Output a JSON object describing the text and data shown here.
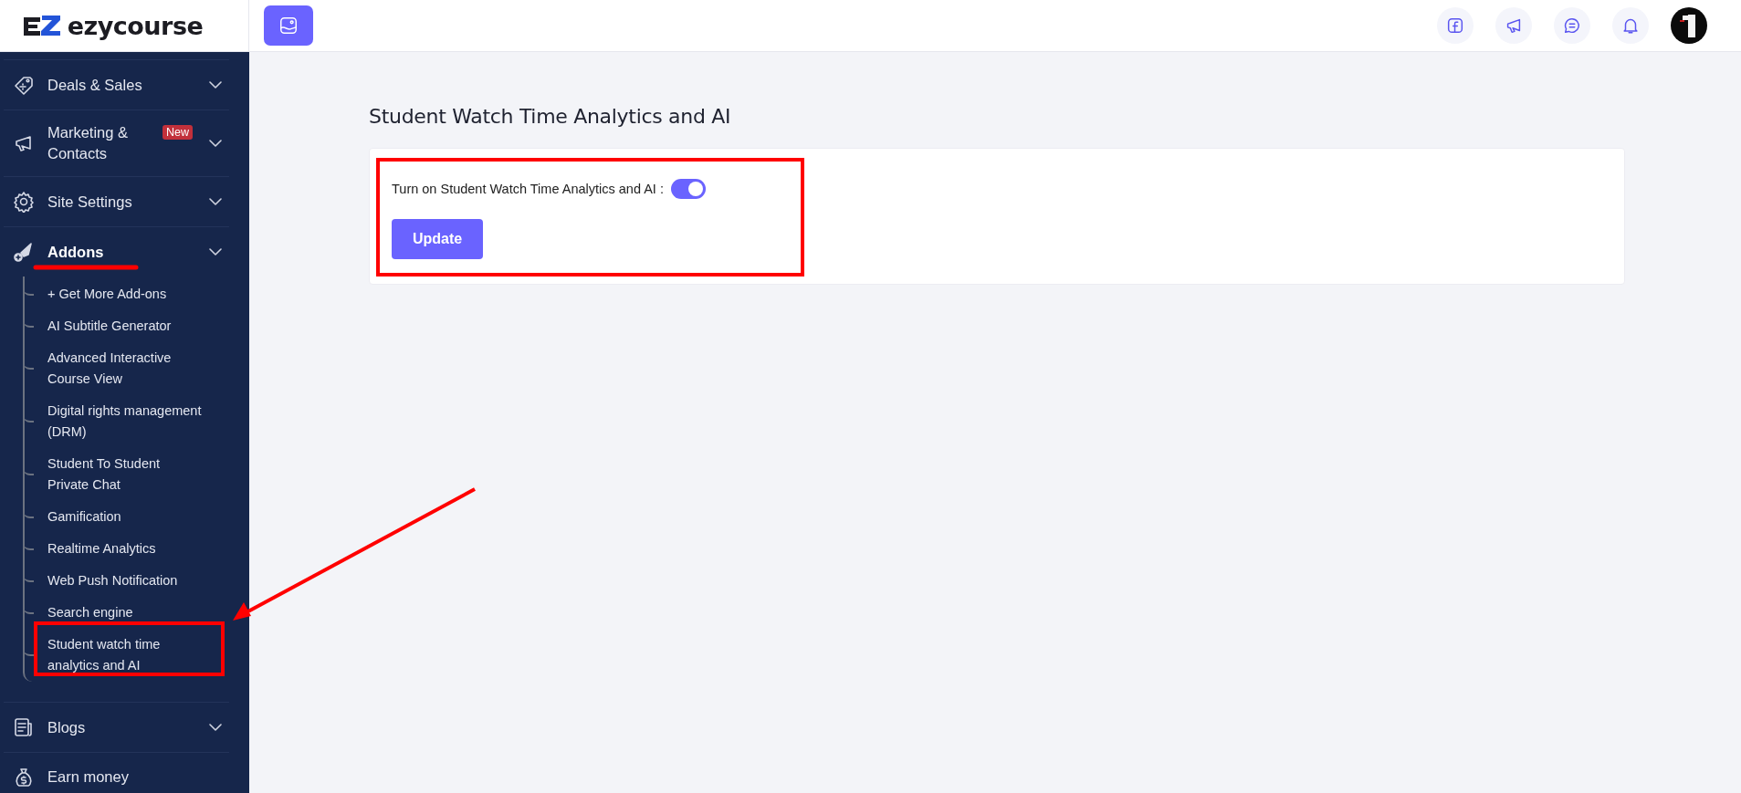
{
  "header": {
    "brand": "ezycourse"
  },
  "sidebar": {
    "items": [
      {
        "label": "Deals & Sales",
        "collapsible": true,
        "active": false
      },
      {
        "label": "Marketing & Contacts",
        "badge": "New",
        "collapsible": true,
        "active": false
      },
      {
        "label": "Site Settings",
        "collapsible": true,
        "active": false
      },
      {
        "label": "Addons",
        "collapsible": true,
        "active": true,
        "children": [
          {
            "label": "+ Get More Add-ons"
          },
          {
            "label": "AI Subtitle Generator"
          },
          {
            "label": "Advanced Interactive Course View"
          },
          {
            "label": "Digital rights management (DRM)"
          },
          {
            "label": "Student To Student Private Chat"
          },
          {
            "label": "Gamification"
          },
          {
            "label": "Realtime Analytics"
          },
          {
            "label": "Web Push Notification"
          },
          {
            "label": "Search engine"
          },
          {
            "label": "Student watch time analytics and AI"
          }
        ]
      },
      {
        "label": "Blogs",
        "collapsible": true,
        "active": false
      },
      {
        "label": "Earn money",
        "collapsible": false,
        "active": false
      }
    ]
  },
  "main": {
    "title": "Student Watch Time Analytics and AI",
    "toggle": {
      "label": "Turn on Student Watch Time Analytics and AI :",
      "on": true
    },
    "button": "Update"
  }
}
